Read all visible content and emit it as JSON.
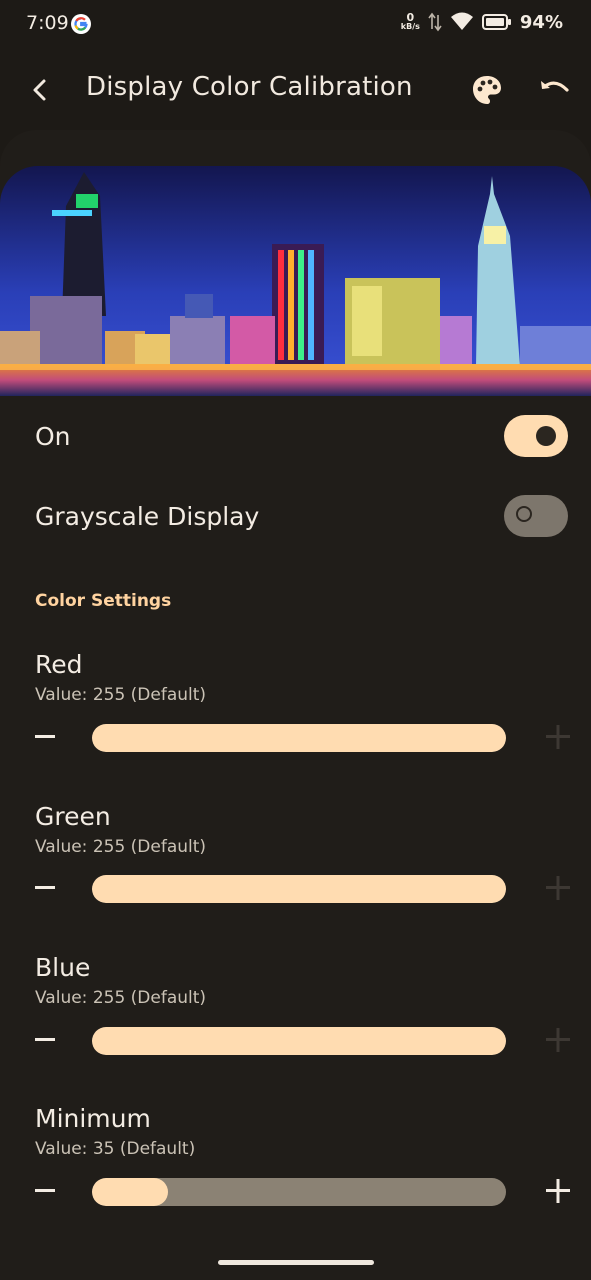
{
  "status_bar": {
    "time": "7:09",
    "net_speed": "0",
    "net_unit": "kB/s",
    "battery": "94%"
  },
  "toolbar": {
    "title": "Display Color Calibration",
    "icons": [
      "back-arrow-icon",
      "palette-icon",
      "undo-icon"
    ]
  },
  "toggles": {
    "on": {
      "label": "On",
      "state": true
    },
    "grayscale": {
      "label": "Grayscale Display",
      "state": false
    }
  },
  "section_title": "Color Settings",
  "settings": [
    {
      "name": "Red",
      "value_text": "Value: 255 (Default)",
      "value": 255,
      "max": 255
    },
    {
      "name": "Green",
      "value_text": "Value: 255 (Default)",
      "value": 255,
      "max": 255
    },
    {
      "name": "Blue",
      "value_text": "Value: 255 (Default)",
      "value": 255,
      "max": 255
    },
    {
      "name": "Minimum",
      "value_text": "Value: 35 (Default)",
      "value": 35,
      "max": 190
    }
  ],
  "colors": {
    "background": "#1d1a16",
    "accent": "#ffdcb1",
    "track": "#8b8274",
    "section": "#ffd3a0"
  }
}
